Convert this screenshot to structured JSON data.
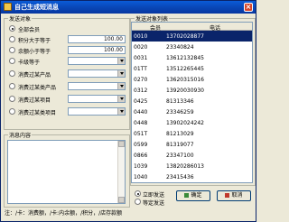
{
  "window": {
    "title": "自己生成短消息",
    "close": "×"
  },
  "target_group": {
    "label": "发送对象",
    "options": [
      {
        "label": "全部会员",
        "selected": true
      },
      {
        "label": "积分大于等于",
        "value": "100.00",
        "selected": false
      },
      {
        "label": "余额小于等于",
        "value": "100.00",
        "selected": false
      },
      {
        "label": "卡级等于",
        "selected": false
      },
      {
        "label": "消费过某产品",
        "selected": false
      },
      {
        "label": "消费过某类产品",
        "selected": false
      },
      {
        "label": "消费过某项目",
        "selected": false
      },
      {
        "label": "消费过某类项目",
        "selected": false
      }
    ]
  },
  "message": {
    "label": "消息内容",
    "value": ""
  },
  "list": {
    "label": "发送对象列表",
    "columns": [
      "会员",
      "电话"
    ],
    "rows": [
      {
        "member": "0010",
        "phone": "13702028877",
        "selected": true
      },
      {
        "member": "0020",
        "phone": "23340824"
      },
      {
        "member": "0031",
        "phone": "13612132845"
      },
      {
        "member": "01TT",
        "phone": "13512265445"
      },
      {
        "member": "0270",
        "phone": "13620315016"
      },
      {
        "member": "0312",
        "phone": "13920030930"
      },
      {
        "member": "0425",
        "phone": "81313346"
      },
      {
        "member": "0440",
        "phone": "23346259"
      },
      {
        "member": "0448",
        "phone": "13902024242"
      },
      {
        "member": "051T",
        "phone": "81213029"
      },
      {
        "member": "0599",
        "phone": "81319077"
      },
      {
        "member": "0866",
        "phone": "23347100"
      },
      {
        "member": "1039",
        "phone": "13820286013"
      },
      {
        "member": "1040",
        "phone": "23415436"
      }
    ]
  },
  "send_mode": {
    "options": [
      {
        "label": "立即发送",
        "selected": true
      },
      {
        "label": "等定发送",
        "selected": false
      }
    ]
  },
  "buttons": {
    "ok": "确定",
    "cancel": "取消"
  },
  "note": "注：/卡：消费额，/卡:内余额，/积分，/店存款额"
}
